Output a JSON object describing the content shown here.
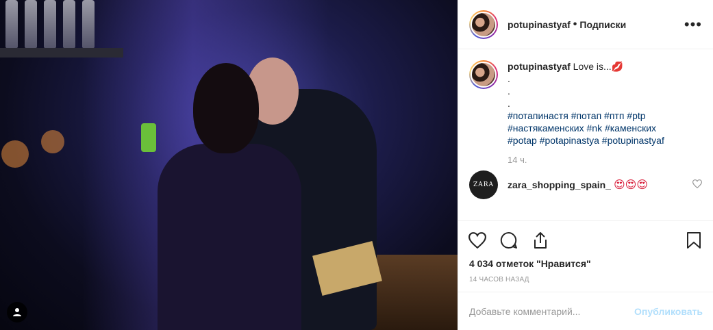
{
  "post": {
    "username": "potupinastyaf",
    "separator": "•",
    "follow_label": "Подписки",
    "more_label": "•••"
  },
  "caption": {
    "username": "potupinastyaf",
    "text": "Love is...",
    "emoji": "💋",
    "dots": [
      ".",
      ".",
      "."
    ],
    "hashtags_line1": "#потапинастя #потап #птп #ptp",
    "hashtags_line2": "#настякаменских #nk #каменских",
    "hashtags_line3": "#potap #potapinastya #potupinastyaf",
    "time": "14 ч."
  },
  "comments": [
    {
      "username": "zara_shopping_spain_",
      "emoji": "😍😍😍",
      "avatar_text": "ZARA"
    }
  ],
  "actions": {
    "likes_text": "4 034 отметок \"Нравится\"",
    "posted_when": "14 ЧАСОВ НАЗАД"
  },
  "add_comment": {
    "placeholder": "Добавьте комментарий...",
    "post_label": "Опубликовать"
  },
  "icons": {
    "like": "heart-icon",
    "comment": "comment-icon",
    "share": "share-icon",
    "save": "bookmark-icon",
    "tagged_user": "user-icon",
    "comment_like": "small-heart-icon"
  },
  "colors": {
    "hashtag": "#003569",
    "secondary_text": "#999999",
    "post_button_disabled": "#b2dffc"
  }
}
